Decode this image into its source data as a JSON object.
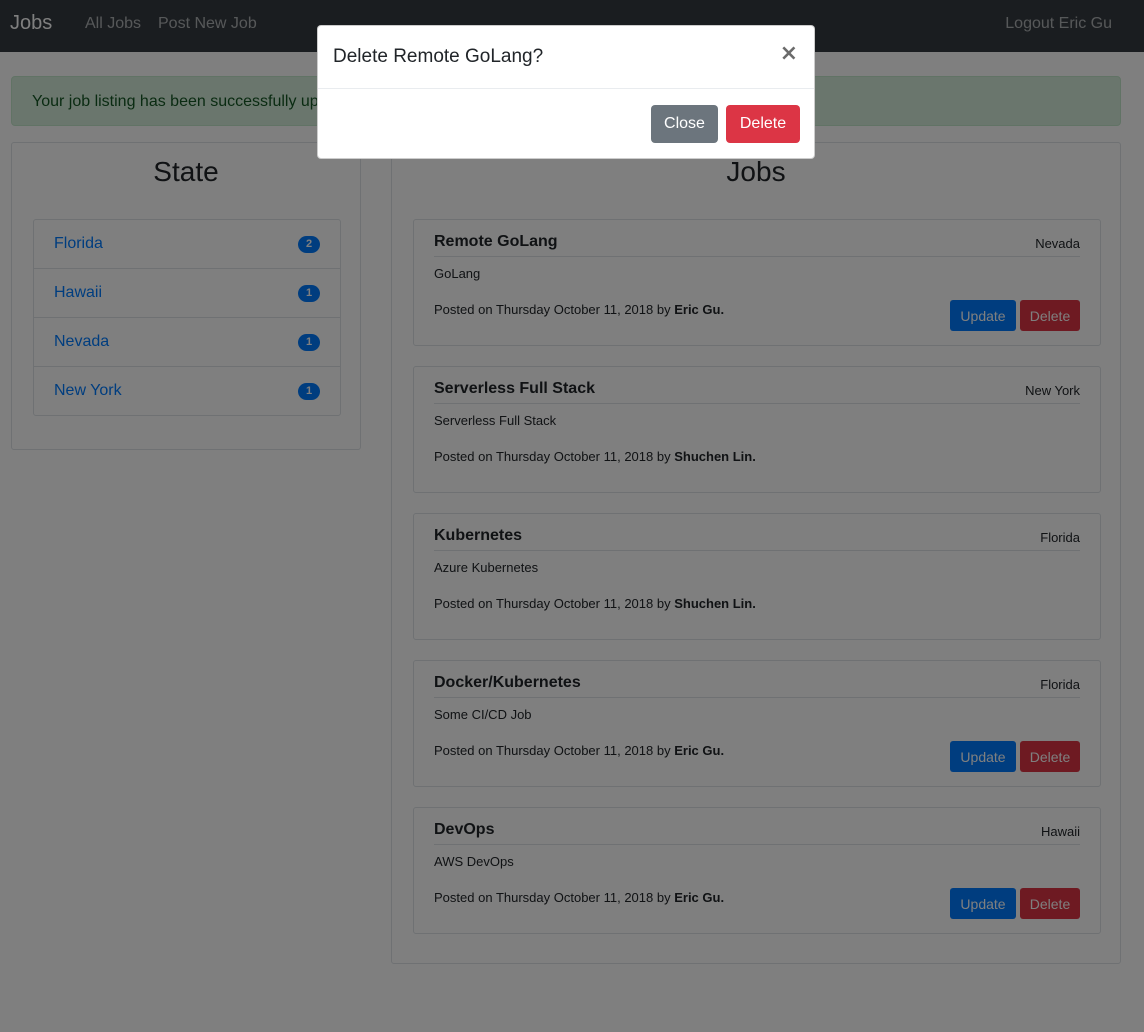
{
  "navbar": {
    "brand": "Jobs",
    "links": [
      "All Jobs",
      "Post New Job"
    ],
    "logout": "Logout Eric Gu"
  },
  "alert": {
    "text": "Your job listing has been successfully updated!"
  },
  "state_panel": {
    "title": "State",
    "items": [
      {
        "label": "Florida",
        "count": "2"
      },
      {
        "label": "Hawaii",
        "count": "1"
      },
      {
        "label": "Nevada",
        "count": "1"
      },
      {
        "label": "New York",
        "count": "1"
      }
    ]
  },
  "jobs_panel": {
    "title": "Jobs",
    "posted_prefix": "Posted on",
    "by_word": "by",
    "update_label": "Update",
    "delete_label": "Delete",
    "jobs": [
      {
        "title": "Remote GoLang",
        "location": "Nevada",
        "description": "GoLang",
        "date": "Thursday October 11, 2018",
        "author": "Eric Gu.",
        "editable": true
      },
      {
        "title": "Serverless Full Stack",
        "location": "New York",
        "description": "Serverless Full Stack",
        "date": "Thursday October 11, 2018",
        "author": "Shuchen Lin.",
        "editable": false
      },
      {
        "title": "Kubernetes",
        "location": "Florida",
        "description": "Azure Kubernetes",
        "date": "Thursday October 11, 2018",
        "author": "Shuchen Lin.",
        "editable": false
      },
      {
        "title": "Docker/Kubernetes",
        "location": "Florida",
        "description": "Some CI/CD Job",
        "date": "Thursday October 11, 2018",
        "author": "Eric Gu.",
        "editable": true
      },
      {
        "title": "DevOps",
        "location": "Hawaii",
        "description": "AWS DevOps",
        "date": "Thursday October 11, 2018",
        "author": "Eric Gu.",
        "editable": true
      }
    ]
  },
  "modal": {
    "title": "Delete Remote GoLang?",
    "close_icon": "×",
    "close_label": "Close",
    "delete_label": "Delete"
  },
  "colors": {
    "navbar": "#343a40",
    "primary": "#007bff",
    "danger": "#dc3545",
    "secondary": "#6c757d",
    "alert_bg": "#d4edda",
    "alert_text": "#155724"
  }
}
